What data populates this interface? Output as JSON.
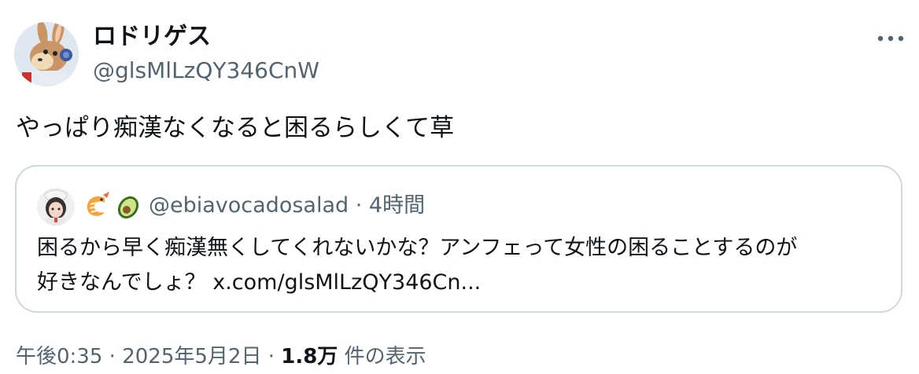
{
  "author": {
    "display_name": "ロドリゲス",
    "handle": "@glsMlLzQY346CnW",
    "avatar_icon": "cartoon-rabbit-avatar-icon"
  },
  "menu": {
    "icon": "more-options-icon"
  },
  "tweet": {
    "text": "やっぱり痴漢なくなると困るらしくて草"
  },
  "quote": {
    "avatar_icon": "quoted-user-avatar-icon",
    "emoji_icons": [
      "shrimp-emoji-icon",
      "avocado-emoji-icon"
    ],
    "handle": "@ebiavocadosalad",
    "separator": " · ",
    "time": "4時間",
    "text_line1": "困るから早く痴漢無くしてくれないかな？アンフェって女性の困ることするのが",
    "text_line2_prefix": "好きなんでしょ？ ",
    "link": "x.com/glsMlLzQY346Cn..."
  },
  "footer": {
    "time": "午後0:35",
    "sep1": " · ",
    "date": "2025年5月2日",
    "sep2": " · ",
    "views_count": "1.8万",
    "views_label": " 件の表示"
  },
  "colors": {
    "text_primary": "#0f1419",
    "text_secondary": "#536471",
    "border": "#cfd9de",
    "background": "#ffffff"
  }
}
